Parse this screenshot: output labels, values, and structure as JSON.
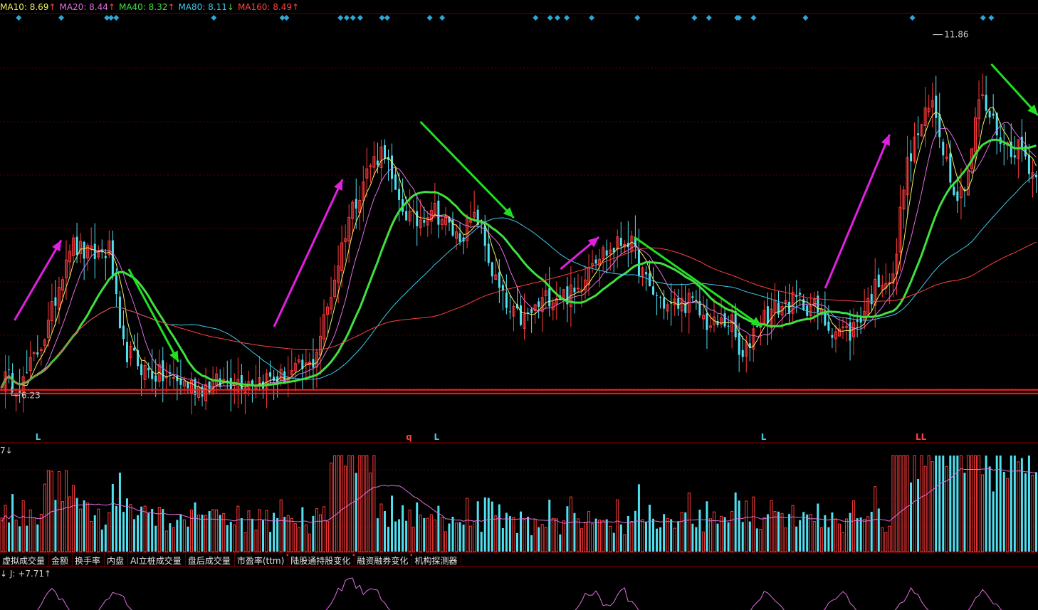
{
  "legend": [
    {
      "label": "MA10: 8.69",
      "arrow": "↑",
      "color": "#f0f060"
    },
    {
      "label": "MA20: 8.44",
      "arrow": "↑",
      "color": "#e070e0"
    },
    {
      "label": "MA40: 8.32",
      "arrow": "↑",
      "color": "#40e040"
    },
    {
      "label": "MA80: 8.11",
      "arrow": "↓",
      "color": "#40c8e8"
    },
    {
      "label": "MA160: 8.49",
      "arrow": "↑",
      "color": "#ff4040"
    }
  ],
  "volume_legend": "7↓",
  "sub_legend": "↓ J: +7.71↑",
  "tabs": [
    {
      "label": "虚拟成交量",
      "dot": false
    },
    {
      "label": "金额",
      "dot": false
    },
    {
      "label": "换手率",
      "dot": false
    },
    {
      "label": "内盘",
      "dot": false
    },
    {
      "label": "AI立桩成交量",
      "dot": false
    },
    {
      "label": "盘后成交量",
      "dot": false
    },
    {
      "label": "市盈率(ttm)",
      "dot": true
    },
    {
      "label": "陆股通持股变化",
      "dot": true
    },
    {
      "label": "融资融券变化",
      "dot": true
    },
    {
      "label": "机构探测器",
      "dot": false
    }
  ],
  "dot_marker": "•",
  "chart_data": {
    "type": "candlestick",
    "price_range": [
      5.6,
      12.2
    ],
    "high_label": "11.86",
    "low_label": "6.23",
    "high_value": 11.86,
    "low_value": 6.23,
    "support_price": 6.28,
    "bottom_marks": [
      {
        "x": 0.034,
        "text": "L",
        "color": "#40c8e8"
      },
      {
        "x": 0.391,
        "text": "q",
        "color": "#ff4040"
      },
      {
        "x": 0.418,
        "text": "L",
        "color": "#40c8e8"
      },
      {
        "x": 0.733,
        "text": "L",
        "color": "#40c8e8"
      },
      {
        "x": 0.882,
        "text": "LL",
        "color": "#ff4040"
      }
    ],
    "signal_diamonds": [
      0.018,
      0.059,
      0.103,
      0.107,
      0.112,
      0.206,
      0.272,
      0.276,
      0.328,
      0.334,
      0.34,
      0.347,
      0.368,
      0.373,
      0.414,
      0.426,
      0.516,
      0.53,
      0.537,
      0.546,
      0.57,
      0.614,
      0.669,
      0.683,
      0.71,
      0.712,
      0.726,
      0.776,
      0.879,
      0.947,
      0.955
    ],
    "anchors": [
      [
        0,
        6.5
      ],
      [
        0.02,
        6.4
      ],
      [
        0.045,
        7.3
      ],
      [
        0.065,
        8.6
      ],
      [
        0.085,
        8.4
      ],
      [
        0.105,
        8.5
      ],
      [
        0.115,
        7.0
      ],
      [
        0.14,
        6.6
      ],
      [
        0.17,
        6.45
      ],
      [
        0.19,
        6.35
      ],
      [
        0.22,
        6.45
      ],
      [
        0.27,
        6.5
      ],
      [
        0.3,
        6.7
      ],
      [
        0.315,
        7.6
      ],
      [
        0.335,
        9.0
      ],
      [
        0.355,
        9.8
      ],
      [
        0.37,
        10.1
      ],
      [
        0.38,
        9.3
      ],
      [
        0.4,
        8.9
      ],
      [
        0.415,
        9.2
      ],
      [
        0.44,
        8.7
      ],
      [
        0.46,
        9.0
      ],
      [
        0.475,
        8.1
      ],
      [
        0.49,
        7.5
      ],
      [
        0.505,
        7.4
      ],
      [
        0.53,
        7.8
      ],
      [
        0.555,
        7.8
      ],
      [
        0.57,
        8.4
      ],
      [
        0.59,
        8.5
      ],
      [
        0.605,
        8.7
      ],
      [
        0.625,
        7.9
      ],
      [
        0.645,
        7.6
      ],
      [
        0.665,
        7.7
      ],
      [
        0.685,
        7.3
      ],
      [
        0.705,
        7.4
      ],
      [
        0.715,
        6.7
      ],
      [
        0.73,
        7.4
      ],
      [
        0.75,
        7.6
      ],
      [
        0.77,
        7.7
      ],
      [
        0.785,
        7.6
      ],
      [
        0.8,
        7.3
      ],
      [
        0.82,
        7.2
      ],
      [
        0.835,
        7.6
      ],
      [
        0.85,
        8.1
      ],
      [
        0.862,
        8.0
      ],
      [
        0.872,
        9.6
      ],
      [
        0.885,
        10.3
      ],
      [
        0.9,
        10.8
      ],
      [
        0.915,
        9.8
      ],
      [
        0.925,
        9.3
      ],
      [
        0.935,
        9.8
      ],
      [
        0.945,
        10.9
      ],
      [
        0.955,
        10.6
      ],
      [
        0.97,
        10.1
      ],
      [
        0.985,
        10.1
      ],
      [
        1.0,
        9.6
      ]
    ],
    "ma_series": [
      {
        "name": "MA10",
        "color": "#f0f060",
        "smooth": 5,
        "lag": 0,
        "width": 1
      },
      {
        "name": "MA20",
        "color": "#e070e0",
        "smooth": 10,
        "lag": 0,
        "width": 1
      },
      {
        "name": "MA40",
        "color": "#40e040",
        "smooth": 22,
        "lag": 0,
        "width": 3
      },
      {
        "name": "MA80",
        "color": "#40c8e8",
        "smooth": 48,
        "lag": 0,
        "width": 1
      },
      {
        "name": "MA160",
        "color": "#ff4040",
        "smooth": 90,
        "lag": 0,
        "width": 1
      }
    ],
    "arrows": [
      {
        "from": [
          0.014,
          7.4
        ],
        "to": [
          0.059,
          8.65
        ],
        "color": "#e020e0"
      },
      {
        "from": [
          0.124,
          8.2
        ],
        "to": [
          0.172,
          6.75
        ],
        "color": "#20e020"
      },
      {
        "from": [
          0.264,
          7.3
        ],
        "to": [
          0.33,
          9.6
        ],
        "color": "#e020e0"
      },
      {
        "from": [
          0.405,
          10.5
        ],
        "to": [
          0.495,
          9.0
        ],
        "color": "#20e020"
      },
      {
        "from": [
          0.54,
          8.2
        ],
        "to": [
          0.577,
          8.7
        ],
        "color": "#e020e0"
      },
      {
        "from": [
          0.611,
          8.7
        ],
        "to": [
          0.734,
          7.3
        ],
        "color": "#20e020"
      },
      {
        "from": [
          0.795,
          7.9
        ],
        "to": [
          0.857,
          10.3
        ],
        "color": "#e020e0"
      },
      {
        "from": [
          0.955,
          11.4
        ],
        "to": [
          1.0,
          10.6
        ],
        "color": "#20e020"
      }
    ]
  }
}
